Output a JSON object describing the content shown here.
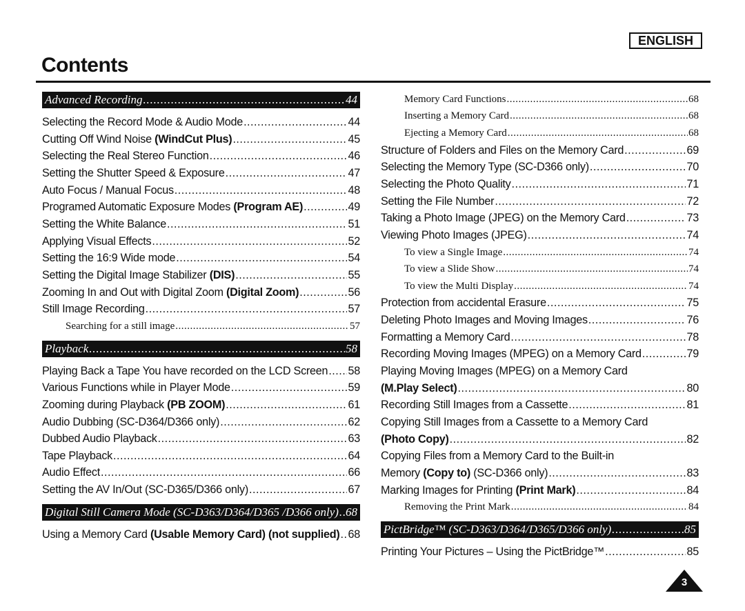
{
  "language_label": "ENGLISH",
  "title": "Contents",
  "page_number": "3",
  "left": [
    {
      "type": "header",
      "text": "Advanced Recording",
      "page": "44"
    },
    {
      "type": "item",
      "parts": [
        {
          "t": "Selecting the Record Mode & Audio Mode "
        }
      ],
      "page": "44"
    },
    {
      "type": "item",
      "parts": [
        {
          "t": "Cutting Off Wind Noise "
        },
        {
          "t": "(WindCut Plus)",
          "b": true
        },
        {
          "t": " "
        }
      ],
      "page": "45"
    },
    {
      "type": "item",
      "parts": [
        {
          "t": "Selecting the Real Stereo Function "
        }
      ],
      "page": "46"
    },
    {
      "type": "item",
      "parts": [
        {
          "t": "Setting the Shutter Speed & Exposure "
        }
      ],
      "page": "47"
    },
    {
      "type": "item",
      "parts": [
        {
          "t": "Auto Focus / Manual Focus"
        }
      ],
      "page": "48"
    },
    {
      "type": "item",
      "parts": [
        {
          "t": "Programed Automatic Exposure Modes "
        },
        {
          "t": "(Program AE)",
          "b": true
        },
        {
          "t": " "
        }
      ],
      "page": "49"
    },
    {
      "type": "item",
      "parts": [
        {
          "t": "Setting the White Balance "
        }
      ],
      "page": "51"
    },
    {
      "type": "item",
      "parts": [
        {
          "t": "Applying Visual Effects"
        }
      ],
      "page": "52"
    },
    {
      "type": "item",
      "parts": [
        {
          "t": "Setting the 16:9 Wide mode"
        }
      ],
      "page": "54"
    },
    {
      "type": "item",
      "parts": [
        {
          "t": "Setting the Digital Image Stabilizer "
        },
        {
          "t": "(DIS)",
          "b": true
        },
        {
          "t": " "
        }
      ],
      "page": "55"
    },
    {
      "type": "item",
      "parts": [
        {
          "t": "Zooming In and Out with Digital Zoom "
        },
        {
          "t": "(Digital Zoom)",
          "b": true
        },
        {
          "t": " "
        }
      ],
      "page": "56"
    },
    {
      "type": "item",
      "parts": [
        {
          "t": "Still Image Recording "
        }
      ],
      "page": "57"
    },
    {
      "type": "sub",
      "parts": [
        {
          "t": "Searching for a still image "
        }
      ],
      "page": "57"
    },
    {
      "type": "header",
      "text": "Playback ",
      "page": "58"
    },
    {
      "type": "item",
      "parts": [
        {
          "t": "Playing Back a Tape You have recorded on the LCD Screen"
        }
      ],
      "page": "58"
    },
    {
      "type": "item",
      "parts": [
        {
          "t": "Various Functions while in Player Mode "
        }
      ],
      "page": "59"
    },
    {
      "type": "item",
      "parts": [
        {
          "t": "Zooming during Playback "
        },
        {
          "t": "(PB ZOOM)",
          "b": true
        },
        {
          "t": " "
        }
      ],
      "page": "61"
    },
    {
      "type": "item",
      "parts": [
        {
          "t": "Audio Dubbing (SC-D364/D366 only) "
        }
      ],
      "page": "62"
    },
    {
      "type": "item",
      "parts": [
        {
          "t": "Dubbed Audio Playback"
        }
      ],
      "page": "63"
    },
    {
      "type": "item",
      "parts": [
        {
          "t": "Tape Playback "
        }
      ],
      "page": "64"
    },
    {
      "type": "item",
      "parts": [
        {
          "t": "Audio Effect "
        }
      ],
      "page": "66"
    },
    {
      "type": "item",
      "parts": [
        {
          "t": "Setting the AV In/Out (SC-D365/D366 only) "
        }
      ],
      "page": "67"
    },
    {
      "type": "header",
      "text": "Digital Still Camera Mode (SC-D363/D364/D365 /D366 only) ",
      "page": "68"
    },
    {
      "type": "item",
      "parts": [
        {
          "t": "Using a Memory Card "
        },
        {
          "t": "(Usable Memory Card) (not supplied)",
          "b": true
        },
        {
          "t": " "
        }
      ],
      "page": "68"
    }
  ],
  "right": [
    {
      "type": "sub",
      "parts": [
        {
          "t": "Memory Card Functions"
        }
      ],
      "page": "68"
    },
    {
      "type": "sub",
      "parts": [
        {
          "t": "Inserting a Memory Card "
        }
      ],
      "page": "68"
    },
    {
      "type": "sub",
      "parts": [
        {
          "t": "Ejecting a Memory Card "
        }
      ],
      "page": "68"
    },
    {
      "type": "item",
      "parts": [
        {
          "t": "Structure of Folders and Files on the Memory Card"
        }
      ],
      "page": "69"
    },
    {
      "type": "item",
      "parts": [
        {
          "t": "Selecting the Memory Type (SC-D366 only) "
        }
      ],
      "page": "70"
    },
    {
      "type": "item",
      "parts": [
        {
          "t": "Selecting the Photo Quality "
        }
      ],
      "page": "71"
    },
    {
      "type": "item",
      "parts": [
        {
          "t": "Setting the File Number "
        }
      ],
      "page": "72"
    },
    {
      "type": "item",
      "parts": [
        {
          "t": "Taking a Photo Image (JPEG) on the Memory Card "
        }
      ],
      "page": "73"
    },
    {
      "type": "item",
      "parts": [
        {
          "t": "Viewing Photo Images (JPEG) "
        }
      ],
      "page": "74"
    },
    {
      "type": "sub",
      "parts": [
        {
          "t": "To view a Single Image "
        }
      ],
      "page": "74"
    },
    {
      "type": "sub",
      "parts": [
        {
          "t": "To view a Slide Show "
        }
      ],
      "page": "74"
    },
    {
      "type": "sub",
      "parts": [
        {
          "t": "To view the Multi Display "
        }
      ],
      "page": "74"
    },
    {
      "type": "item",
      "parts": [
        {
          "t": "Protection from accidental Erasure "
        }
      ],
      "page": "75"
    },
    {
      "type": "item",
      "parts": [
        {
          "t": "Deleting Photo Images and Moving Images "
        }
      ],
      "page": "76"
    },
    {
      "type": "item",
      "parts": [
        {
          "t": "Formatting a Memory Card "
        }
      ],
      "page": "78"
    },
    {
      "type": "item",
      "parts": [
        {
          "t": "Recording Moving Images (MPEG) on a Memory Card "
        }
      ],
      "page": "79"
    },
    {
      "type": "line",
      "parts": [
        {
          "t": "Playing Moving Images (MPEG) on a Memory Card"
        }
      ]
    },
    {
      "type": "item",
      "parts": [
        {
          "t": "(M.Play Select)",
          "b": true
        },
        {
          "t": " "
        }
      ],
      "page": "80"
    },
    {
      "type": "item",
      "parts": [
        {
          "t": "Recording Still Images from a Cassette "
        }
      ],
      "page": "81"
    },
    {
      "type": "line",
      "parts": [
        {
          "t": "Copying Still Images from a Cassette to a Memory Card"
        }
      ]
    },
    {
      "type": "item",
      "parts": [
        {
          "t": "(Photo Copy)",
          "b": true
        }
      ],
      "page": "82"
    },
    {
      "type": "line",
      "parts": [
        {
          "t": "Copying Files from a Memory Card to the Built-in"
        }
      ]
    },
    {
      "type": "item",
      "parts": [
        {
          "t": "Memory "
        },
        {
          "t": "(Copy to)",
          "b": true
        },
        {
          "t": " (SC-D366 only) "
        }
      ],
      "page": "83"
    },
    {
      "type": "item",
      "parts": [
        {
          "t": "Marking Images for Printing "
        },
        {
          "t": "(Print Mark)",
          "b": true
        },
        {
          "t": " "
        }
      ],
      "page": "84"
    },
    {
      "type": "sub",
      "parts": [
        {
          "t": "Removing the Print Mark"
        }
      ],
      "page": "84"
    },
    {
      "type": "header",
      "text": "PictBridge™ (SC-D363/D364/D365/D366 only) ",
      "page": "85"
    },
    {
      "type": "item",
      "parts": [
        {
          "t": "Printing Your Pictures – Using the PictBridge™"
        }
      ],
      "page": "85"
    }
  ],
  "colors": {
    "text": "#111111",
    "header_bg": "#111111",
    "header_text": "#ffffff"
  }
}
